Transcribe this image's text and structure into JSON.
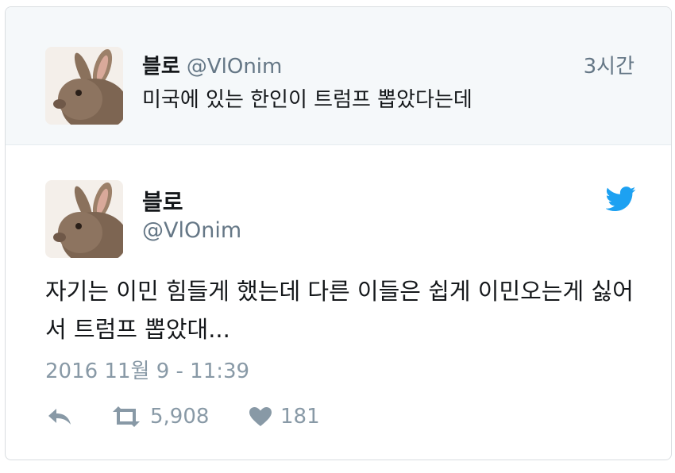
{
  "parent_tweet": {
    "name": "블로",
    "handle": "@VlOnim",
    "time": "3시간",
    "text": "미국에 있는 한인이 트럼프 뽑았다는데"
  },
  "tweet": {
    "name": "블로",
    "handle": "@VlOnim",
    "text": "자기는 이민 힘들게 했는데 다른 이들은 쉽게 이민오는게 싫어서 트럼프 뽑았대...",
    "timestamp": "2016 11월 9 - 11:39",
    "retweet_count": "5,908",
    "like_count": "181"
  },
  "icons": {
    "reply": "reply-icon",
    "retweet": "retweet-icon",
    "like": "heart-icon",
    "brand": "twitter-bird-icon",
    "avatar": "rabbit-avatar"
  },
  "colors": {
    "brand_blue": "#1da1f2",
    "secondary_text": "#657786",
    "muted": "#8899a6",
    "parent_bg": "#f5f8fa"
  }
}
